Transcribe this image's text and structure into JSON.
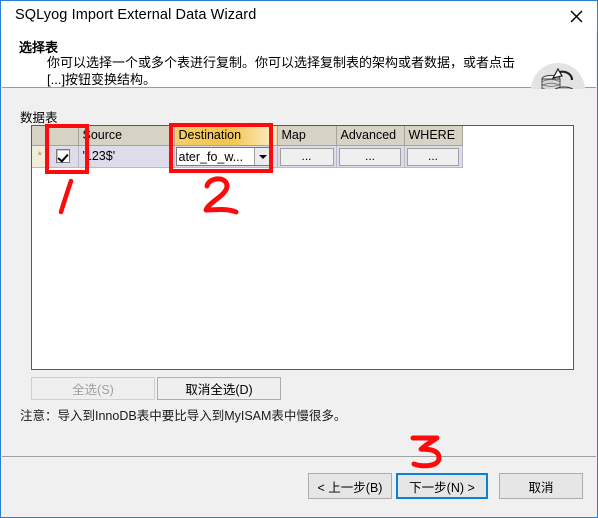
{
  "window": {
    "title": "SQLyog Import External Data Wizard",
    "close_icon": "close-icon"
  },
  "header": {
    "title": "选择表",
    "description": "你可以选择一个或多个表进行复制。你可以选择复制表的架构或者数据，或者点击[...]按钮变换结构。",
    "icon": "database-copy-icon"
  },
  "body": {
    "datatable_label": "数据表",
    "grid": {
      "columns": [
        {
          "key": "marker",
          "label": ""
        },
        {
          "key": "check",
          "label": ""
        },
        {
          "key": "source",
          "label": "Source"
        },
        {
          "key": "destination",
          "label": "Destination",
          "highlighted": true
        },
        {
          "key": "map",
          "label": "Map"
        },
        {
          "key": "advanced",
          "label": "Advanced"
        },
        {
          "key": "where",
          "label": "WHERE"
        }
      ],
      "rows": [
        {
          "marker": "*",
          "checked": true,
          "source": "'123$'",
          "destination": "ater_fo_w...",
          "map": "...",
          "advanced": "...",
          "where": "..."
        }
      ]
    },
    "select_all_label": "全选(S)",
    "deselect_all_label": "取消全选(D)",
    "note": "注意：导入到InnoDB表中要比导入到MyISAM表中慢很多。"
  },
  "footer": {
    "prev_label": "< 上一步(B)",
    "next_label": "下一步(N) >",
    "cancel_label": "取消"
  },
  "annotations": {
    "color": "#fb0b0b",
    "marks": [
      {
        "name": "annotation-number-1",
        "text": "1"
      },
      {
        "name": "annotation-number-2",
        "text": "2"
      },
      {
        "name": "annotation-number-3",
        "text": "3"
      }
    ]
  }
}
